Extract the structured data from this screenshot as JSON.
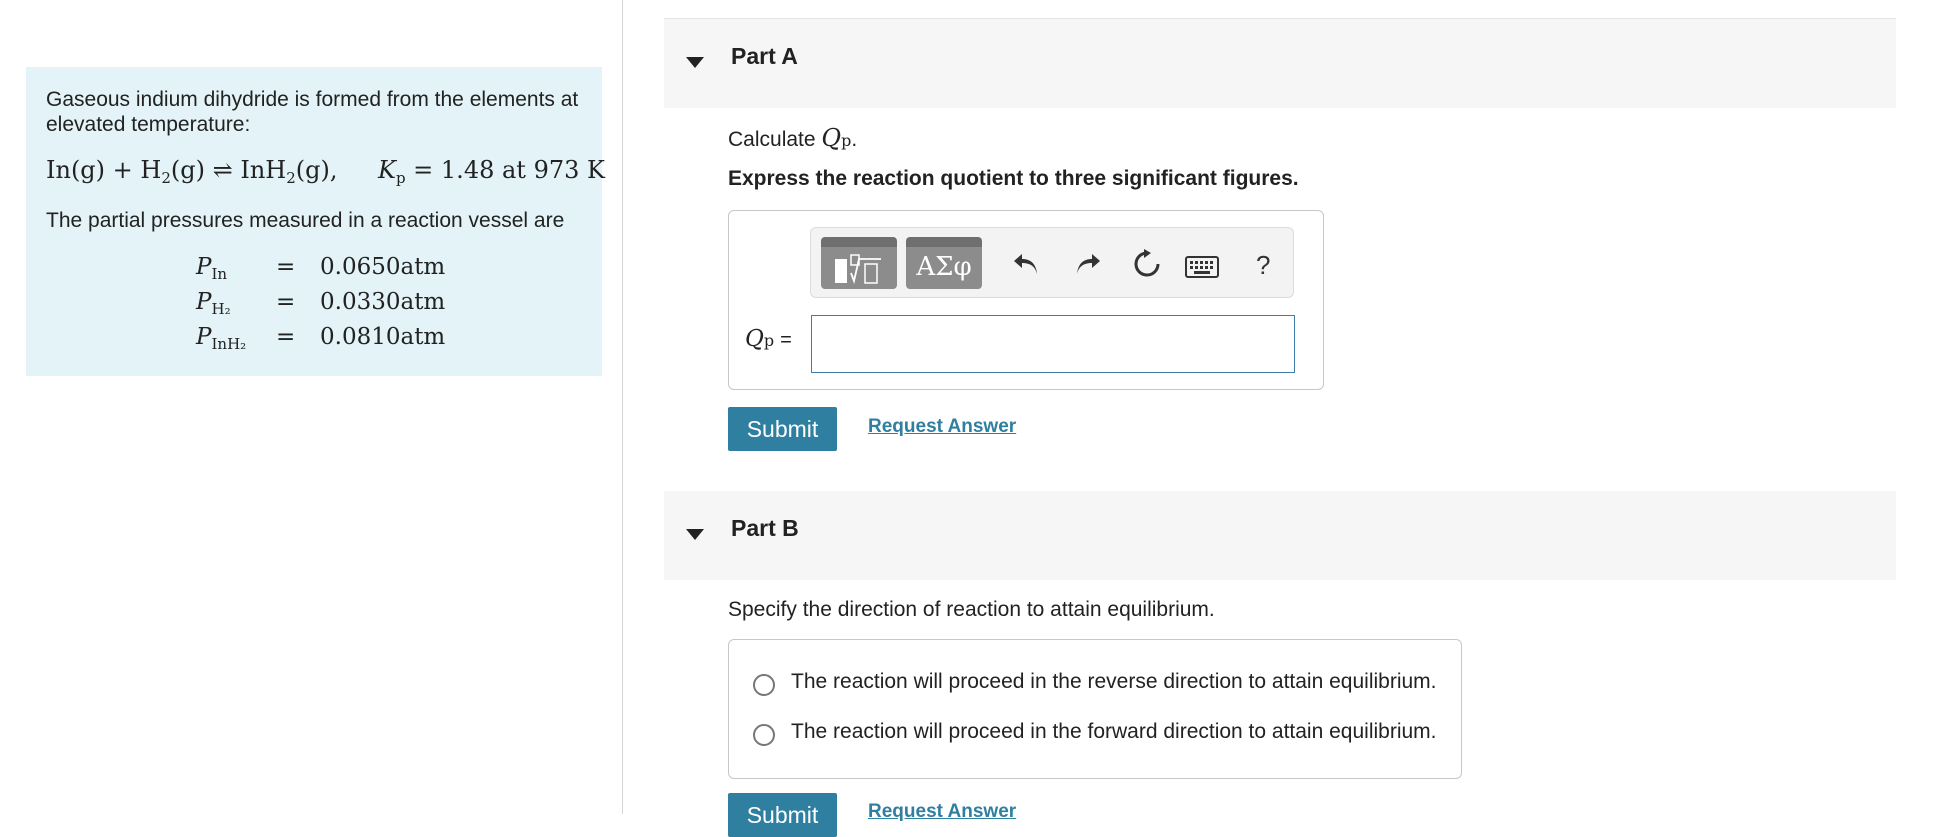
{
  "problem": {
    "intro": "Gaseous indium dihydride is formed from the elements at elevated temperature:",
    "equation": {
      "reactant1": "In(g) + H",
      "reactant_sub": "2",
      "reactant2": "(g) ⇌ InH",
      "product_sub": "2",
      "product_end": "(g),",
      "kp_symbol": "K",
      "kp_sub": "p",
      "kp_rest": " = 1.48 at 973 K"
    },
    "pressures_intro": "The partial pressures measured in a reaction vessel are",
    "pressures": [
      {
        "symbol": "P",
        "sub": "In",
        "value": "0.0650atm"
      },
      {
        "symbol": "P",
        "sub": "H₂",
        "value": "0.0330atm"
      },
      {
        "symbol": "P",
        "sub": "InH₂",
        "value": "0.0810atm"
      }
    ]
  },
  "part_a": {
    "title": "Part A",
    "calc_prefix": "Calculate ",
    "calc_symbol": "Q",
    "calc_sub": "p",
    "calc_suffix": ".",
    "instruction": "Express the reaction quotient to three significant figures.",
    "toolbar": {
      "greek_label": "ΑΣφ",
      "undo_icon": "undo-icon",
      "redo_icon": "redo-icon",
      "reset_icon": "reset-icon",
      "keyboard_icon": "keyboard-icon",
      "help_label": "?"
    },
    "answer_label_symbol": "Q",
    "answer_label_sub": "p",
    "answer_label_eq": "=",
    "answer_value": "",
    "submit_label": "Submit",
    "request_label": "Request Answer"
  },
  "part_b": {
    "title": "Part B",
    "prompt": "Specify the direction of reaction to attain equilibrium.",
    "options": [
      "The reaction will proceed in the reverse direction to attain equilibrium.",
      "The reaction will proceed in the forward direction to attain equilibrium."
    ],
    "submit_label": "Submit",
    "request_label": "Request Answer"
  }
}
